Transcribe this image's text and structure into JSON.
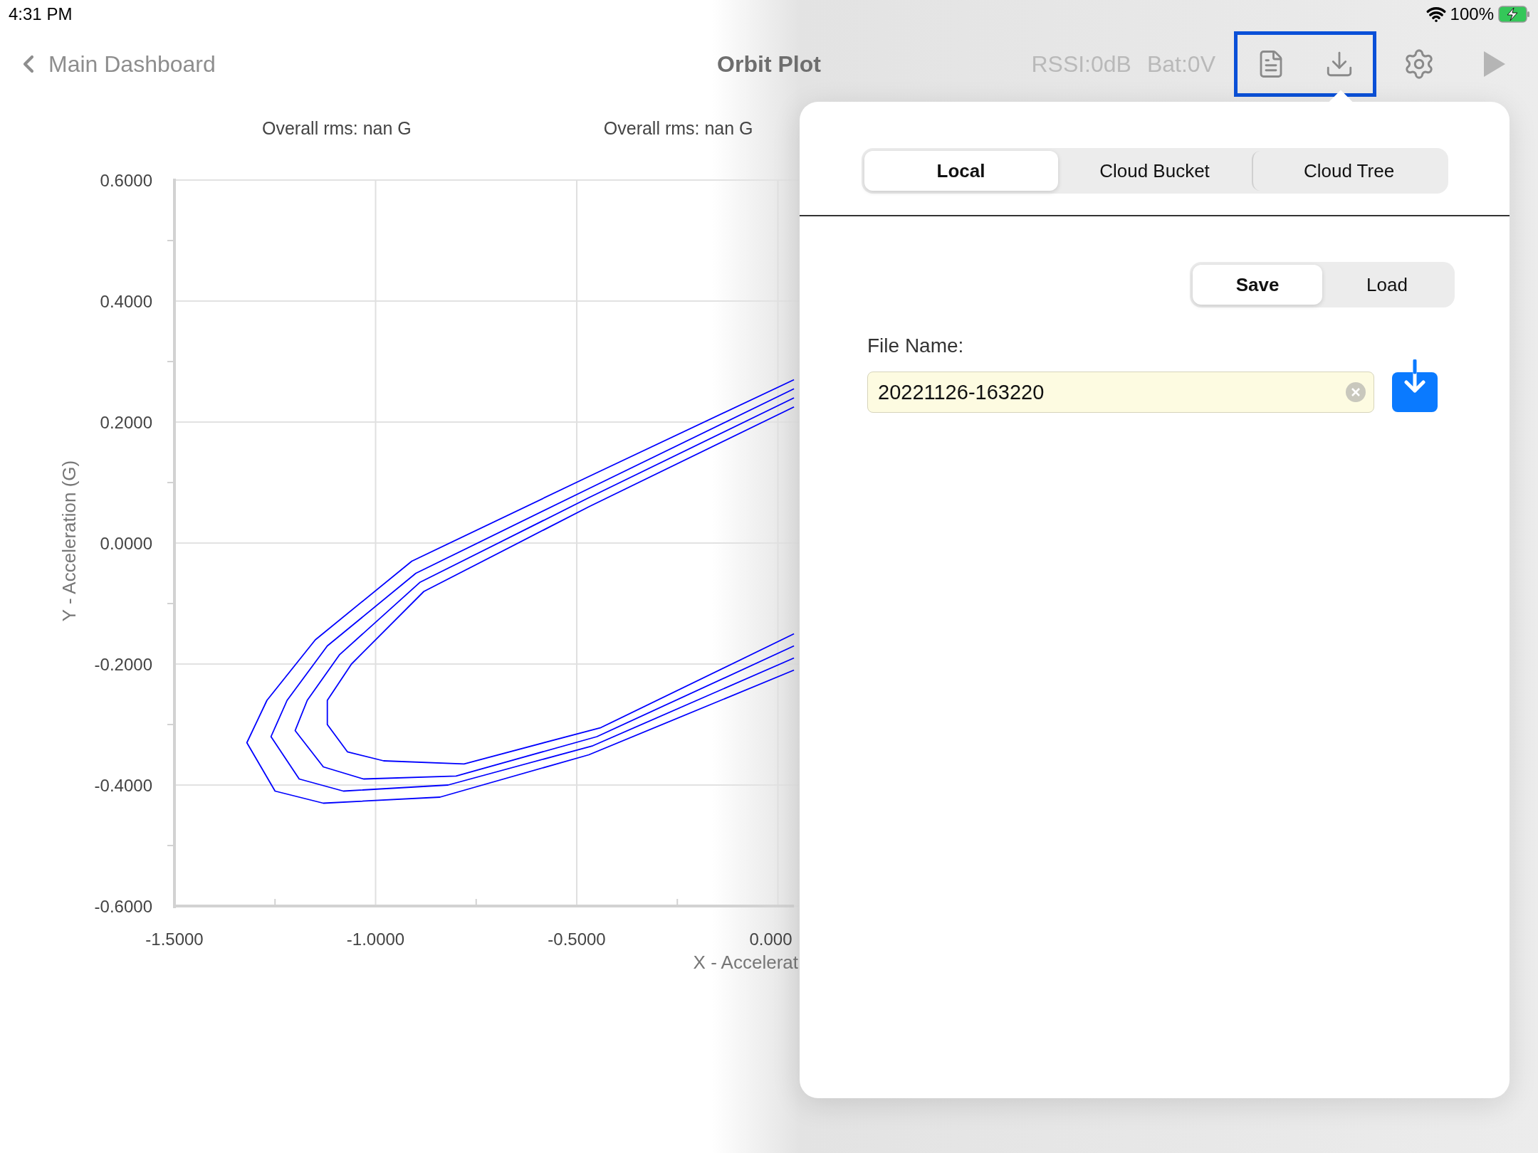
{
  "status_bar": {
    "time": "4:31 PM",
    "battery": "100%"
  },
  "nav": {
    "back": "Main Dashboard",
    "title": "Orbit Plot",
    "rssi": "RSSI:0dB",
    "battery": "Bat:0V"
  },
  "chart": {
    "rms_labels": [
      "Overall rms: nan G",
      "Overall rms: nan G"
    ],
    "chart_data": {
      "type": "line",
      "xlabel": "X - Accelerat",
      "ylabel": "Y - Acceleration (G)",
      "grid": true,
      "xlim": [
        -1.5,
        0.04
      ],
      "ylim": [
        -0.6,
        0.6
      ],
      "x": [
        0.04,
        -0.47,
        -0.91,
        -1.15,
        -1.27,
        -1.32,
        -1.25,
        -1.13,
        -0.84,
        -0.47,
        0.04,
        0.04,
        -0.47,
        -0.9,
        -1.12,
        -1.22,
        -1.26,
        -1.19,
        -1.08,
        -0.82,
        -0.46,
        0.04,
        0.04,
        -0.47,
        -0.89,
        -1.09,
        -1.17,
        -1.2,
        -1.13,
        -1.03,
        -0.8,
        -0.45,
        0.04,
        0.04,
        -0.47,
        -0.88,
        -1.06,
        -1.12,
        -1.12,
        -1.07,
        -0.98,
        -0.78,
        -0.44,
        0.04
      ],
      "series": [
        {
          "color": "#0000ff",
          "values": [
            0.27,
            0.11,
            -0.03,
            -0.16,
            -0.26,
            -0.33,
            -0.41,
            -0.43,
            -0.42,
            -0.35,
            -0.21,
            0.255,
            0.09,
            -0.05,
            -0.17,
            -0.26,
            -0.32,
            -0.39,
            -0.41,
            -0.4,
            -0.335,
            -0.19,
            0.24,
            0.075,
            -0.065,
            -0.185,
            -0.26,
            -0.31,
            -0.37,
            -0.39,
            -0.385,
            -0.32,
            -0.17,
            0.225,
            0.06,
            -0.08,
            -0.2,
            -0.26,
            -0.3,
            -0.345,
            -0.36,
            -0.365,
            -0.305,
            -0.15
          ]
        }
      ],
      "xticks": [
        {
          "value": -1.5,
          "label": "-1.5000"
        },
        {
          "value": -1,
          "label": "-1.0000"
        },
        {
          "value": -0.5,
          "label": "-0.5000"
        },
        {
          "value": 0,
          "label": "0.000"
        }
      ],
      "yticks": [
        {
          "value": 0.6,
          "label": "0.6000"
        },
        {
          "value": 0.4,
          "label": "0.4000"
        },
        {
          "value": 0.2,
          "label": "0.2000"
        },
        {
          "value": 0,
          "label": "0.0000"
        },
        {
          "value": -0.2,
          "label": "-0.2000"
        },
        {
          "value": -0.4,
          "label": "-0.4000"
        },
        {
          "value": -0.6,
          "label": "-0.6000"
        }
      ]
    }
  },
  "popover": {
    "tabs": [
      {
        "label": "Local",
        "selected": true
      },
      {
        "label": "Cloud Bucket",
        "selected": false
      },
      {
        "label": "Cloud Tree",
        "selected": false
      }
    ],
    "modes": [
      {
        "label": "Save",
        "selected": true
      },
      {
        "label": "Load",
        "selected": false
      }
    ],
    "file_name": {
      "label": "File Name:",
      "value": "20221126-163220"
    }
  }
}
